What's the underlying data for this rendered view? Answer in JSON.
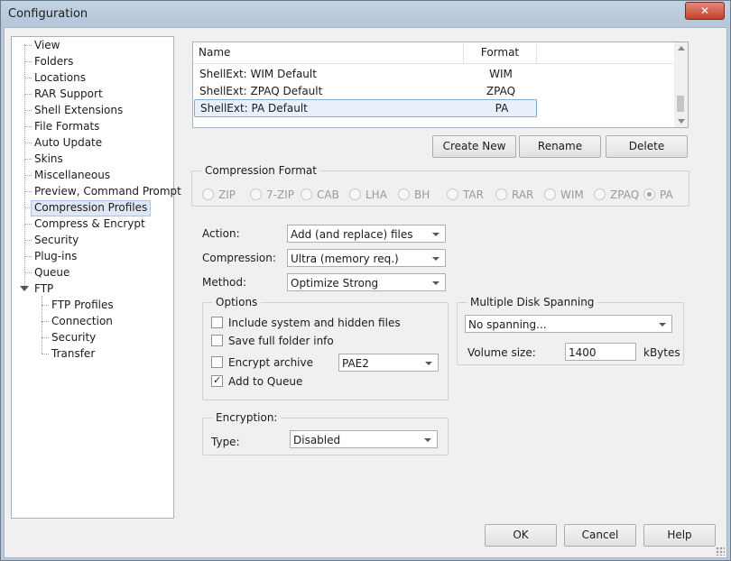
{
  "window": {
    "title": "Configuration",
    "close_glyph": "✕"
  },
  "tree": {
    "items": [
      "View",
      "Folders",
      "Locations",
      "RAR Support",
      "Shell Extensions",
      "File Formats",
      "Auto Update",
      "Skins",
      "Miscellaneous",
      "Preview, Command Prompt",
      "Compression Profiles",
      "Compress & Encrypt",
      "Security",
      "Plug-ins",
      "Queue",
      "FTP"
    ],
    "selected": "Compression Profiles",
    "ftp_children": [
      "FTP Profiles",
      "Connection",
      "Security",
      "Transfer"
    ]
  },
  "profiles": {
    "columns": {
      "name": "Name",
      "format": "Format"
    },
    "rows": [
      {
        "name": "ShellExt: WIM Default",
        "format": "WIM"
      },
      {
        "name": "ShellExt: ZPAQ Default",
        "format": "ZPAQ"
      },
      {
        "name": "ShellExt: PA Default",
        "format": "PA"
      }
    ],
    "selected_row": 2
  },
  "buttons": {
    "create_new": "Create New",
    "rename": "Rename",
    "delete": "Delete",
    "ok": "OK",
    "cancel": "Cancel",
    "help": "Help"
  },
  "compression_format": {
    "title": "Compression Format",
    "options": [
      "ZIP",
      "7-ZIP",
      "CAB",
      "LHA",
      "BH",
      "TAR",
      "RAR",
      "WIM",
      "ZPAQ",
      "PA"
    ],
    "selected": "PA"
  },
  "settings": {
    "action_label": "Action:",
    "action_value": "Add (and replace) files",
    "compression_label": "Compression:",
    "compression_value": "Ultra (memory req.)",
    "method_label": "Method:",
    "method_value": "Optimize Strong"
  },
  "options": {
    "title": "Options",
    "include_system": {
      "label": "Include system and hidden files",
      "checked": false
    },
    "save_folder_info": {
      "label": "Save full folder info",
      "checked": false
    },
    "encrypt_archive": {
      "label": "Encrypt archive",
      "checked": false,
      "method": "PAE2"
    },
    "add_to_queue": {
      "label": "Add to Queue",
      "checked": true
    }
  },
  "spanning": {
    "title": "Multiple Disk Spanning",
    "value": "No spanning...",
    "volume_label": "Volume size:",
    "volume_value": "1400",
    "unit": "kBytes"
  },
  "encryption": {
    "title": "Encryption:",
    "type_label": "Type:",
    "type_value": "Disabled"
  }
}
